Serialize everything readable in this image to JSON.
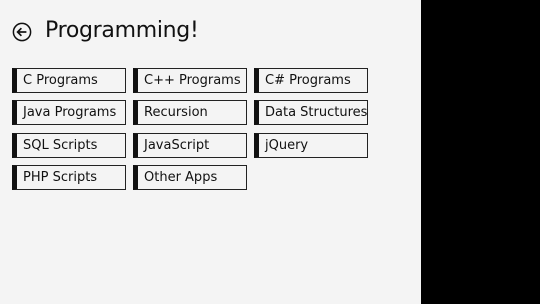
{
  "page": {
    "title": "Programming!"
  },
  "icons": {
    "back": "back-arrow-circle-icon"
  },
  "colors": {
    "background": "#f4f4f4",
    "text": "#111111",
    "tile_border": "#222222",
    "side_pane": "#000000"
  },
  "tiles": [
    {
      "label": "C Programs"
    },
    {
      "label": "C++ Programs"
    },
    {
      "label": "C# Programs"
    },
    {
      "label": "Java Programs"
    },
    {
      "label": "Recursion"
    },
    {
      "label": "Data Structures"
    },
    {
      "label": "SQL Scripts"
    },
    {
      "label": "JavaScript"
    },
    {
      "label": "jQuery"
    },
    {
      "label": "PHP Scripts"
    },
    {
      "label": "Other Apps"
    }
  ]
}
